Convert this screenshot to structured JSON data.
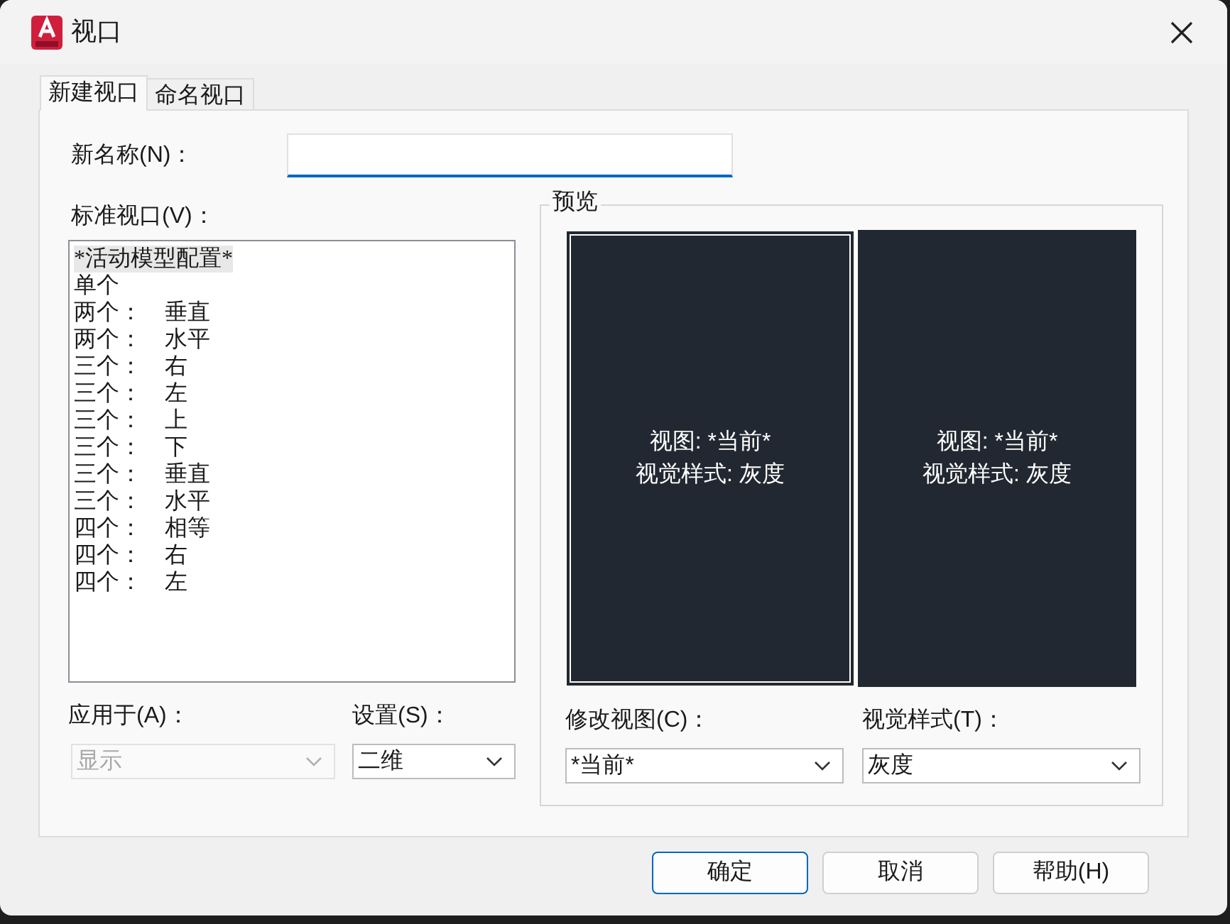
{
  "window": {
    "title": "视口"
  },
  "tabs": [
    {
      "label": "新建视口",
      "selected": true
    },
    {
      "label": "命名视口",
      "selected": false
    }
  ],
  "new_name": {
    "label": "新名称(N)："
  },
  "standard_viewports": {
    "label": "标准视口(V)：",
    "items": [
      {
        "count": "*活动模型配置*",
        "selected": true
      },
      {
        "count": "单个",
        "selected": false
      },
      {
        "count": "两个：",
        "layout": "垂直",
        "selected": false
      },
      {
        "count": "两个：",
        "layout": "水平",
        "selected": false
      },
      {
        "count": "三个：",
        "layout": "右",
        "selected": false
      },
      {
        "count": "三个：",
        "layout": "左",
        "selected": false
      },
      {
        "count": "三个：",
        "layout": "上",
        "selected": false
      },
      {
        "count": "三个：",
        "layout": "下",
        "selected": false
      },
      {
        "count": "三个：",
        "layout": "垂直",
        "selected": false
      },
      {
        "count": "三个：",
        "layout": "水平",
        "selected": false
      },
      {
        "count": "四个：",
        "layout": "相等",
        "selected": false
      },
      {
        "count": "四个：",
        "layout": "右",
        "selected": false
      },
      {
        "count": "四个：",
        "layout": "左",
        "selected": false
      }
    ]
  },
  "apply_to": {
    "label": "应用于(A)：",
    "value": "显示",
    "disabled": true
  },
  "setup": {
    "label": "设置(S)：",
    "value": "二维",
    "disabled": false
  },
  "preview": {
    "title": "预览",
    "panes": [
      {
        "view": "视图: *当前*",
        "style": "视觉样式: 灰度",
        "selected": true
      },
      {
        "view": "视图: *当前*",
        "style": "视觉样式: 灰度",
        "selected": false
      }
    ]
  },
  "change_view": {
    "label": "修改视图(C)：",
    "value": "*当前*",
    "disabled": false
  },
  "visual_style": {
    "label": "视觉样式(T)：",
    "value": "灰度",
    "disabled": false
  },
  "buttons": [
    {
      "label": "确定",
      "default": true
    },
    {
      "label": "取消",
      "default": false
    },
    {
      "label": "帮助(H)",
      "default": false
    }
  ]
}
